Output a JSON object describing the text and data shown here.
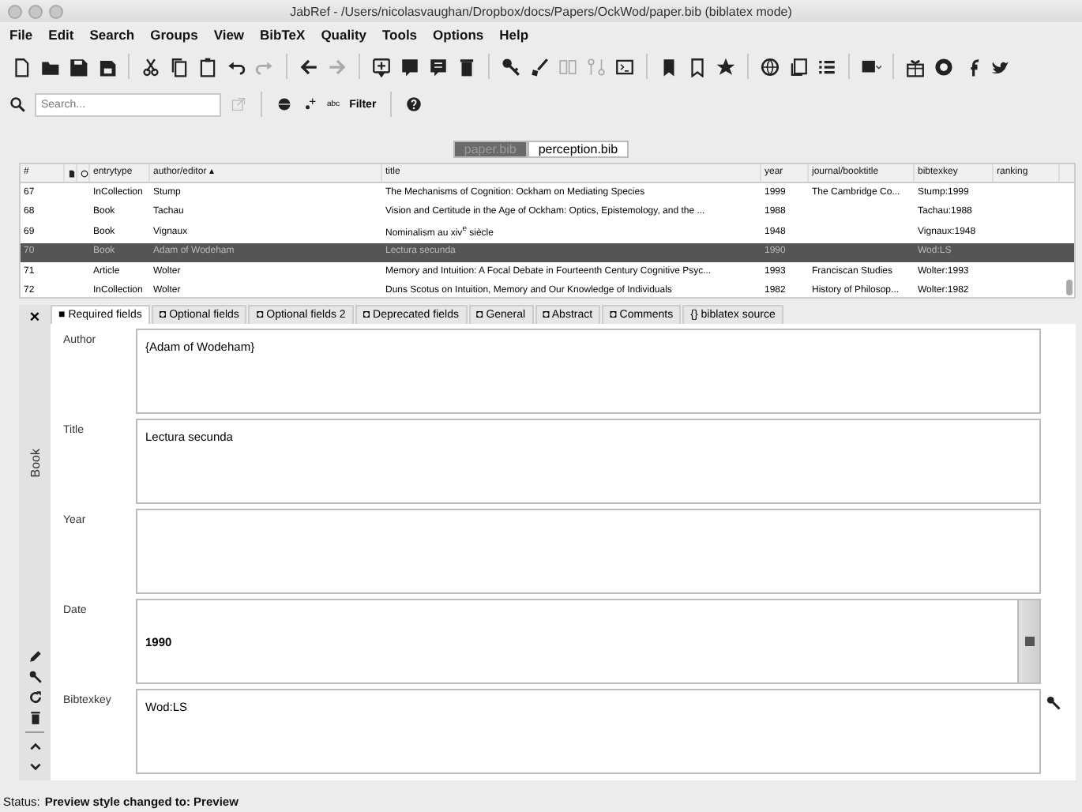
{
  "window": {
    "title": "JabRef - /Users/nicolasvaughan/Dropbox/docs/Papers/OckWod/paper.bib (biblatex mode)"
  },
  "menu": [
    "File",
    "Edit",
    "Search",
    "Groups",
    "View",
    "BibTeX",
    "Quality",
    "Tools",
    "Options",
    "Help"
  ],
  "search": {
    "placeholder": "Search...",
    "filter_label": "Filter",
    "regex_label": "abc"
  },
  "library_tabs": [
    {
      "label": "paper.bib",
      "selected": true
    },
    {
      "label": "perception.bib",
      "selected": false
    }
  ],
  "table": {
    "columns": [
      "#",
      "entrytype",
      "author/editor ▴",
      "title",
      "year",
      "journal/booktitle",
      "bibtexkey",
      "ranking"
    ],
    "rows": [
      {
        "number": "67",
        "entrytype": "InCollection",
        "author": "Stump",
        "title": "The Mechanisms of Cognition: Ockham on Mediating Species",
        "year": "1999",
        "journal": "The Cambridge Co...",
        "key": "Stump:1999",
        "selected": false
      },
      {
        "number": "68",
        "entrytype": "Book",
        "author": "Tachau",
        "title": "Vision and Certitude in the Age of Ockham: Optics, Epistemology, and the ...",
        "year": "1988",
        "journal": "",
        "key": "Tachau:1988",
        "selected": false
      },
      {
        "number": "69",
        "entrytype": "Book",
        "author": "Vignaux",
        "title": "Nominalism au xiv$^{e}$ siècle",
        "year": "1948",
        "journal": "",
        "key": "Vignaux:1948",
        "selected": false
      },
      {
        "number": "70",
        "entrytype": "Book",
        "author": "Adam of Wodeham",
        "title": "Lectura secunda",
        "year": "1990",
        "journal": "",
        "key": "Wod:LS",
        "selected": true
      },
      {
        "number": "71",
        "entrytype": "Article",
        "author": "Wolter",
        "title": "Memory and Intuition: A Focal Debate in Fourteenth Century Cognitive Psyc...",
        "year": "1993",
        "journal": "Franciscan Studies",
        "key": "Wolter:1993",
        "selected": false
      },
      {
        "number": "72",
        "entrytype": "InCollection",
        "author": "Wolter",
        "title": "Duns Scotus on Intuition, Memory and Our Knowledge of Individuals",
        "year": "1982",
        "journal": "History of Philosop...",
        "key": "Wolter:1982",
        "selected": false
      }
    ]
  },
  "editor": {
    "close_label": "×",
    "entry_type": "Book",
    "tabs": [
      {
        "icon": "■",
        "label": "Required fields",
        "selected": true
      },
      {
        "icon": "◘",
        "label": "Optional fields",
        "selected": false
      },
      {
        "icon": "◘",
        "label": "Optional fields 2",
        "selected": false
      },
      {
        "icon": "◘",
        "label": "Deprecated fields",
        "selected": false
      },
      {
        "icon": "◘",
        "label": "General",
        "selected": false
      },
      {
        "icon": "◘",
        "label": "Abstract",
        "selected": false
      },
      {
        "icon": "◘",
        "label": "Comments",
        "selected": false
      },
      {
        "icon": "{}",
        "label": "biblatex source",
        "selected": false
      }
    ],
    "fields": [
      {
        "label": "Author",
        "value": "{Adam of Wodeham}",
        "kind": "text"
      },
      {
        "label": "Title",
        "value": "Lectura secunda",
        "kind": "text"
      },
      {
        "label": "Year",
        "kind": "text"
      },
      {
        "label": "Date",
        "value": "1990",
        "kind": "date"
      },
      {
        "label": "Bibtexkey",
        "value": "Wod:LS",
        "kind": "key"
      }
    ]
  },
  "status_bar": {
    "label": "Status:",
    "message": "Preview style changed to: Preview"
  }
}
